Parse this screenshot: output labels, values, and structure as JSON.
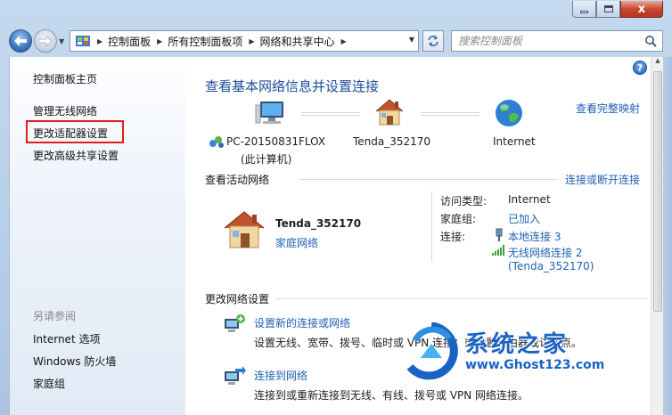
{
  "window": {
    "minimize_label": "",
    "maximize_label": "",
    "close_label": "x"
  },
  "addressbar": {
    "breadcrumbs": [
      "控制面板",
      "所有控制面板项",
      "网络和共享中心"
    ],
    "search_placeholder": "搜索控制面板"
  },
  "sidebar": {
    "home": "控制面板主页",
    "items": [
      "管理无线网络",
      "更改适配器设置",
      "更改高级共享设置"
    ],
    "see_also_title": "另请参阅",
    "see_also": [
      "Internet 选项",
      "Windows 防火墙",
      "家庭组"
    ]
  },
  "main": {
    "title": "查看基本网络信息并设置连接",
    "full_map_link": "查看完整映射",
    "map": {
      "pc_name": "PC-20150831FLOX",
      "pc_sub": "(此计算机)",
      "router": "Tenda_352170",
      "internet": "Internet"
    },
    "active_networks_title": "查看活动网络",
    "connect_disconnect_link": "连接或断开连接",
    "network": {
      "name": "Tenda_352170",
      "type_link": "家庭网络",
      "access_type_label": "访问类型:",
      "access_type_value": "Internet",
      "homegroup_label": "家庭组:",
      "homegroup_value": "已加入",
      "connections_label": "连接:",
      "connection_1": "本地连接 3",
      "connection_2": "无线网络连接 2",
      "connection_2_sub": "(Tenda_352170)"
    },
    "change_settings_title": "更改网络设置",
    "tasks": [
      {
        "link": "设置新的连接或网络",
        "desc": "设置无线、宽带、拨号、临时或 VPN 连接；或设置路由器或访问点。"
      },
      {
        "link": "连接到网络",
        "desc": "连接到或重新连接到无线、有线、拨号或 VPN 网络连接。"
      }
    ]
  },
  "watermark": {
    "brand": "系统之家",
    "url": "www.Ghost123.com"
  },
  "colors": {
    "link": "#1e61b3",
    "title": "#1c4c9c",
    "highlight": "#e31b1b",
    "frame": "#b9cfe8"
  }
}
